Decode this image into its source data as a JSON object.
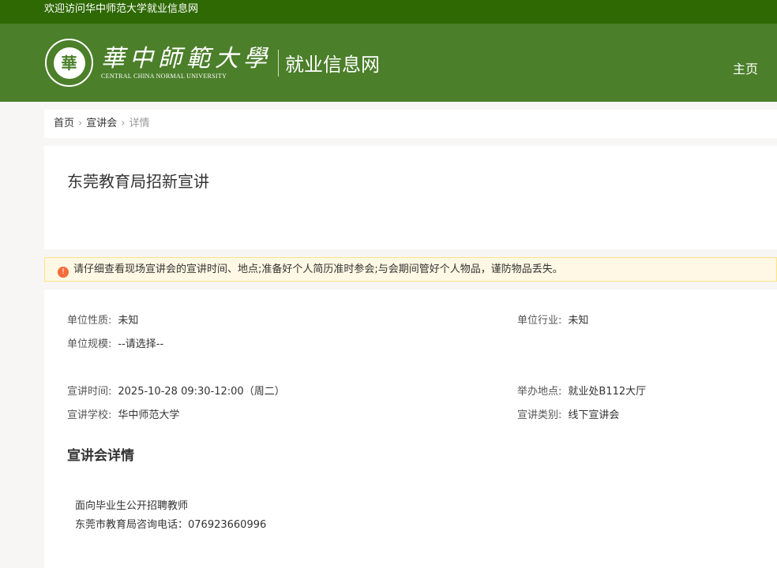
{
  "topbar": {
    "welcome": "欢迎访问华中师范大学就业信息网"
  },
  "header": {
    "logo_cn": "華中師範大學",
    "logo_en": "CENTRAL CHINA NORMAL UNIVERSITY",
    "seal": "華",
    "site_name": "就业信息网",
    "nav_home": "主页"
  },
  "breadcrumb": {
    "items": [
      "首页",
      "宣讲会",
      "详情"
    ]
  },
  "title": "东莞教育局招新宣讲",
  "notice": "请仔细查看现场宣讲会的宣讲时间、地点;准备好个人简历准时参会;与会期间管好个人物品，谨防物品丢失。",
  "fields": {
    "nature": {
      "label": "单位性质:",
      "value": "未知"
    },
    "industry": {
      "label": "单位行业:",
      "value": "未知"
    },
    "scale": {
      "label": "单位规模:",
      "value": "--请选择--"
    },
    "time": {
      "label": "宣讲时间:",
      "value": "2025-10-28 09:30-12:00（周二）"
    },
    "place": {
      "label": "举办地点:",
      "value": "就业处B112大厅"
    },
    "school": {
      "label": "宣讲学校:",
      "value": "华中师范大学"
    },
    "type": {
      "label": "宣讲类别:",
      "value": "线下宣讲会"
    }
  },
  "details": {
    "heading": "宣讲会详情",
    "lines": [
      "面向毕业生公开招聘教师",
      "东莞市教育局咨询电话：076923660996"
    ]
  }
}
